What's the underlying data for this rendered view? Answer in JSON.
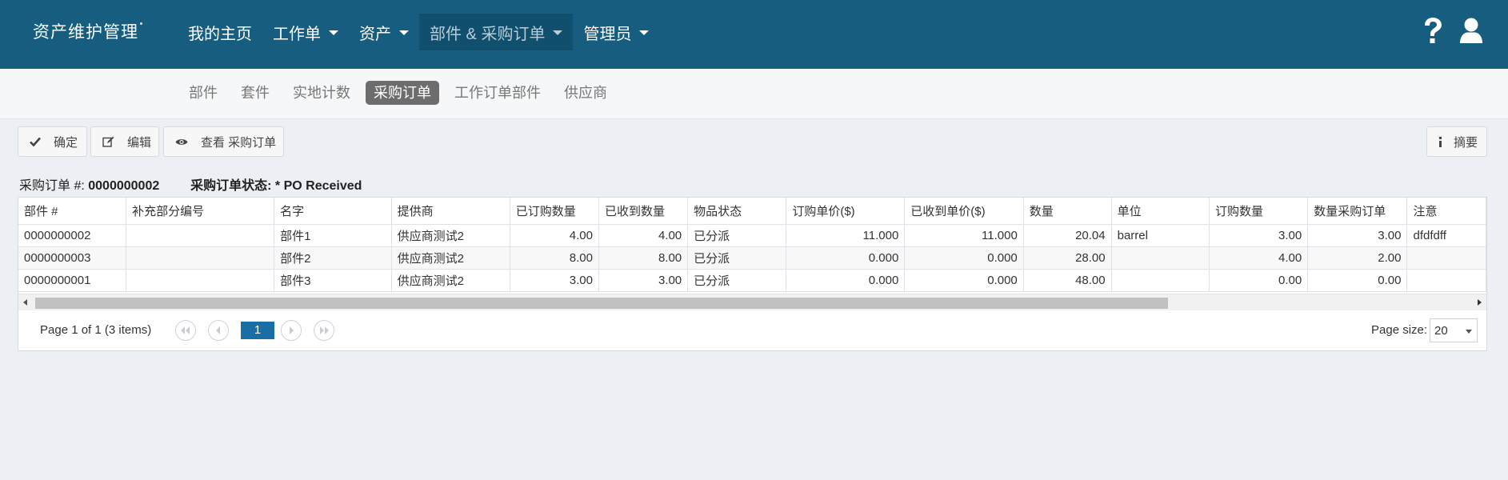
{
  "app": {
    "brand": "资产维护管理"
  },
  "nav": {
    "home": "我的主页",
    "work_orders": "工作单",
    "assets": "资产",
    "parts_po": "部件 & 采购订单",
    "admin": "管理员"
  },
  "icons": {
    "help": "question-icon",
    "user": "user-icon"
  },
  "subtabs": [
    "部件",
    "套件",
    "实地计数",
    "采购订单",
    "工作订单部件",
    "供应商"
  ],
  "subtabs_active": "采购订单",
  "toolbar": {
    "confirm_label": "确定",
    "edit_label": "编辑",
    "view_label": "查看 采购订单",
    "summary_label": "摘要"
  },
  "po": {
    "number_label": "采购订单 #:",
    "number_value": "0000000002",
    "status_label": "采购订单状态: *",
    "status_value": "PO Received"
  },
  "table": {
    "columns": [
      "部件 #",
      "补充部分编号",
      "名字",
      "提供商",
      "已订购数量",
      "已收到数量",
      "物品状态",
      "订购单价($)",
      "已收到单价($)",
      "数量",
      "单位",
      "订购数量",
      "数量采购订单",
      "注意"
    ],
    "rows": [
      [
        "0000000002",
        "",
        "部件1",
        "供应商测试2",
        "4.00",
        "4.00",
        "已分派",
        "11.000",
        "11.000",
        "20.04",
        "barrel",
        "3.00",
        "3.00",
        "dfdfdff"
      ],
      [
        "0000000003",
        "",
        "部件2",
        "供应商测试2",
        "8.00",
        "8.00",
        "已分派",
        "0.000",
        "0.000",
        "28.00",
        "",
        "4.00",
        "2.00",
        ""
      ],
      [
        "0000000001",
        "",
        "部件3",
        "供应商测试2",
        "3.00",
        "3.00",
        "已分派",
        "0.000",
        "0.000",
        "48.00",
        "",
        "0.00",
        "0.00",
        ""
      ]
    ]
  },
  "pager": {
    "info": "Page 1 of 1 (3 items)",
    "current_page": "1",
    "page_size_label": "Page size:",
    "page_size": "20"
  },
  "colors": {
    "navbar": "#175d80",
    "active_nav": "#104f6e",
    "page_bg": "#eceff3",
    "pager_current": "#1a6ea5"
  }
}
